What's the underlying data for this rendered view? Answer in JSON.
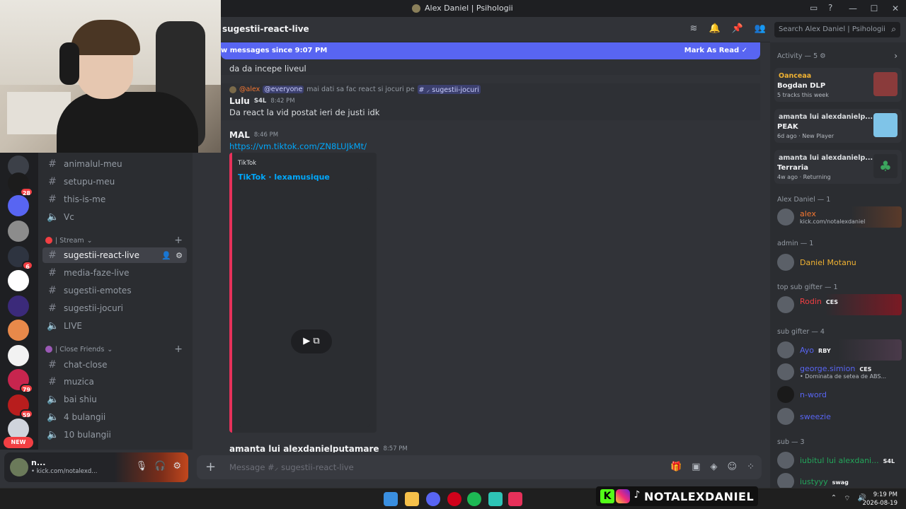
{
  "window": {
    "title": "Alex Daniel | Psihologii",
    "controls": [
      "—",
      "☐",
      "✕"
    ]
  },
  "channel_header": {
    "name": "sugestii-react-live",
    "search_placeholder": "Search Alex Daniel | Psihologii"
  },
  "new_messages_bar": {
    "text": "w messages since 9:07 PM",
    "action": "Mark As Read"
  },
  "sidebar": {
    "channels_top": [
      {
        "label": "animalul-meu",
        "type": "text"
      },
      {
        "label": "setupu-meu",
        "type": "text"
      },
      {
        "label": "this-is-me",
        "type": "text"
      },
      {
        "label": "Vc",
        "type": "voice"
      }
    ],
    "category_stream": "| Stream",
    "stream_channels": [
      {
        "label": "sugestii-react-live",
        "type": "text",
        "active": true
      },
      {
        "label": "media-faze-live",
        "type": "text"
      },
      {
        "label": "sugestii-emotes",
        "type": "text"
      },
      {
        "label": "sugestii-jocuri",
        "type": "text"
      },
      {
        "label": "LIVE",
        "type": "voice"
      }
    ],
    "category_friends": "| Close Friends",
    "friends_channels": [
      {
        "label": "chat-close",
        "type": "text"
      },
      {
        "label": "muzica",
        "type": "text"
      },
      {
        "label": "bai shiu",
        "type": "voice"
      },
      {
        "label": "4 bulangii",
        "type": "voice"
      },
      {
        "label": "10 bulangii",
        "type": "voice"
      }
    ]
  },
  "servers": {
    "badges": [
      "28",
      "6",
      "79",
      "59"
    ],
    "new_label": "NEW"
  },
  "user_panel": {
    "name": "n...",
    "status": "• kick.com/notalexd..."
  },
  "messages": {
    "m1_text": "da da incepe liveul",
    "m2_reply_user": "@alex",
    "m2_reply_mention": "@everyone",
    "m2_reply_text": "mai dati sa fac react si jocuri pe",
    "m2_reply_channel": "# ⸝ sugestii-jocuri",
    "m2_author": "Lulu",
    "m2_tag": "S4L",
    "m2_time": "8:42 PM",
    "m2_text": "Da react la vid postat ieri de justi idk",
    "m3_author": "MAL",
    "m3_time": "8:46 PM",
    "m3_link": "https://vm.tiktok.com/ZN8LUJkMt/",
    "embed_provider": "TikTok",
    "embed_title": "TikTok · lexamusique",
    "m4_author": "amanta lui alexdanielputamare",
    "m4_time": "8:57 PM"
  },
  "composer": {
    "placeholder": "Message #⸝ sugestii-react-live"
  },
  "members": {
    "activity_head": "Activity — 5",
    "activities": [
      {
        "l1": "Oanceaa",
        "l2": "Bogdan DLP",
        "l3": "5 tracks this week"
      },
      {
        "l1": "amanta lui alexdanielp...",
        "l2": "PEAK",
        "l3": "6d ago · New Player"
      },
      {
        "l1": "amanta lui alexdanielp...",
        "l2": "Terraria",
        "l3": "4w ago · Returning"
      }
    ],
    "sections": [
      {
        "title": "Alex Daniel — 1"
      },
      {
        "title": "admin — 1"
      },
      {
        "title": "top sub gifter — 1"
      },
      {
        "title": "sub gifter — 4"
      },
      {
        "title": "sub — 3"
      }
    ],
    "alex": {
      "name": "alex",
      "sub": "kick.com/notalexdaniel"
    },
    "admin": {
      "name": "Daniel Motanu"
    },
    "topgifter": {
      "name": "Rodin",
      "badge": "CES"
    },
    "gifters": [
      {
        "name": "Ayo",
        "badge": "RBY",
        "sub": ""
      },
      {
        "name": "george.simion",
        "badge": "CES",
        "sub": "• Dominata de setea de ABS..."
      },
      {
        "name": "n-word",
        "badge": "",
        "sub": ""
      },
      {
        "name": "sweezie",
        "badge": "",
        "sub": ""
      }
    ],
    "subs": [
      {
        "name": "iubitul lui alexdani...",
        "badge": "S4L"
      },
      {
        "name": "iustyyy",
        "badge": "swag"
      }
    ]
  },
  "taskbar": {
    "social_handle": "NOTALEXDANIEL",
    "time": "9:19 PM",
    "date": "2026-08-19"
  },
  "colors": {
    "accent": "#5865f2",
    "embed_border": "#e6315a",
    "admin_name": "#f0b232",
    "alex_name": "#f57731",
    "sub_name": "#23a55a",
    "gifter_name": "#5865f2",
    "top_gifter_name": "#f23f43"
  }
}
